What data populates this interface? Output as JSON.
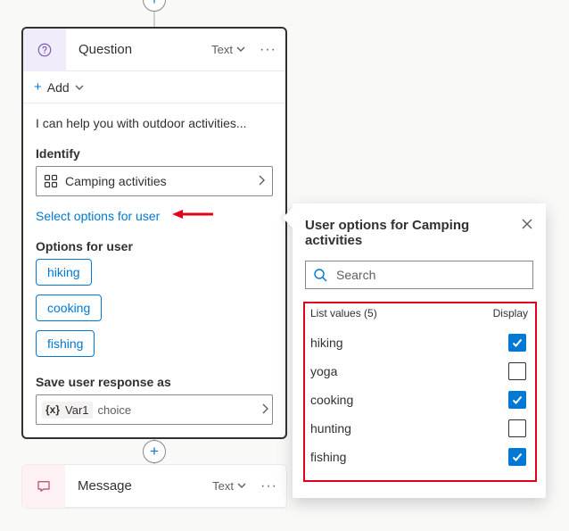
{
  "plus_glyph": "+",
  "question": {
    "title": "Question",
    "type": "Text",
    "add_label": "Add",
    "message": "I can help you with outdoor activities...",
    "identify_label": "Identify",
    "entity": "Camping activities",
    "select_link": "Select options for user",
    "options_label": "Options for user",
    "options": [
      "hiking",
      "cooking",
      "fishing"
    ],
    "save_label": "Save user response as",
    "var_name": "Var1",
    "var_type": "choice"
  },
  "message_card": {
    "title": "Message",
    "type": "Text"
  },
  "popover": {
    "title": "User options for Camping activities",
    "search_placeholder": "Search",
    "list_count": 5,
    "list_values_label": "List values (5)",
    "display_label": "Display",
    "items": [
      {
        "label": "hiking",
        "checked": true
      },
      {
        "label": "yoga",
        "checked": false
      },
      {
        "label": "cooking",
        "checked": true
      },
      {
        "label": "hunting",
        "checked": false
      },
      {
        "label": "fishing",
        "checked": true
      }
    ]
  }
}
